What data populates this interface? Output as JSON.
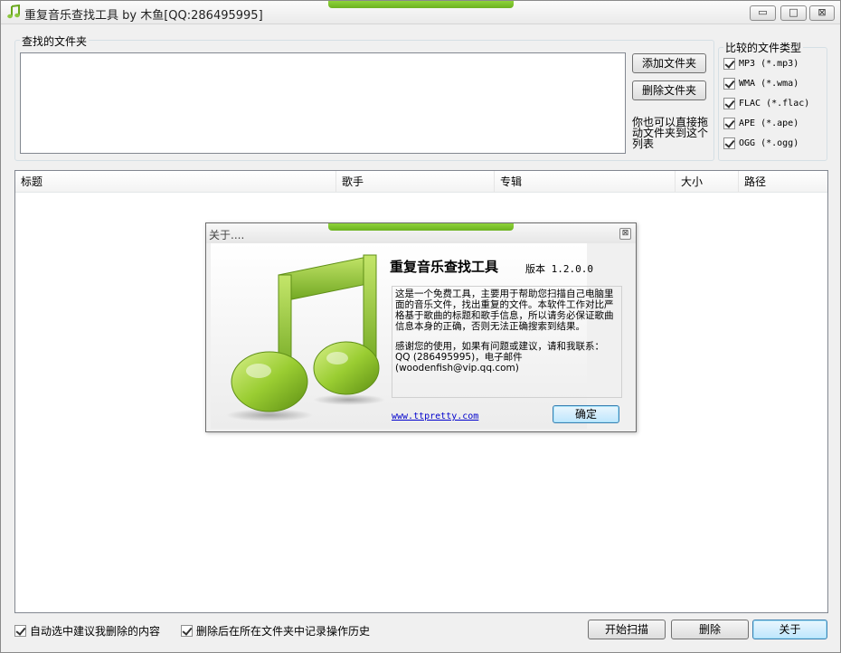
{
  "window": {
    "title": "重复音乐查找工具 by 木鱼[QQ:286495995]",
    "controls": {
      "minimize": "▭",
      "maximize": "□",
      "close": "⊠"
    },
    "icon": "music-note-icon",
    "accent_color": "#7cc52a"
  },
  "folders": {
    "group_label": "查找的文件夹",
    "add_button": "添加文件夹",
    "remove_button": "删除文件夹",
    "drag_hint": "你也可以直接拖动文件夹到这个列表"
  },
  "file_types": {
    "group_label": "比较的文件类型",
    "items": [
      {
        "label": "MP3 (*.mp3)",
        "checked": true
      },
      {
        "label": "WMA (*.wma)",
        "checked": true
      },
      {
        "label": "FLAC (*.flac)",
        "checked": true
      },
      {
        "label": "APE (*.ape)",
        "checked": true
      },
      {
        "label": "OGG (*.ogg)",
        "checked": true
      }
    ]
  },
  "results": {
    "columns": [
      "标题",
      "歌手",
      "专辑",
      "大小",
      "路径"
    ]
  },
  "options": {
    "auto_select": {
      "label": "自动选中建议我删除的内容",
      "checked": true
    },
    "log_history": {
      "label": "删除后在所在文件夹中记录操作历史",
      "checked": true
    }
  },
  "actions": {
    "scan": "开始扫描",
    "delete": "删除",
    "about": "关于"
  },
  "about_dialog": {
    "title": "关于....",
    "close": "⊠",
    "app_name": "重复音乐查找工具",
    "version": "版本 1.2.0.0",
    "desc_p1": "这是一个免费工具，主要用于帮助您扫描自己电脑里面的音乐文件，找出重复的文件。本软件工作对比严格基于歌曲的标题和歌手信息，所以请务必保证歌曲信息本身的正确，否则无法正确搜索到结果。",
    "desc_p2": "感谢您的使用，如果有问题或建议，请和我联系：QQ (286495995)，电子邮件 (woodenfish@vip.qq.com)",
    "link": "www.ttpretty.com",
    "ok_button": "确定",
    "art_icon": "music-note-icon",
    "note_color": "#8cc63f"
  }
}
